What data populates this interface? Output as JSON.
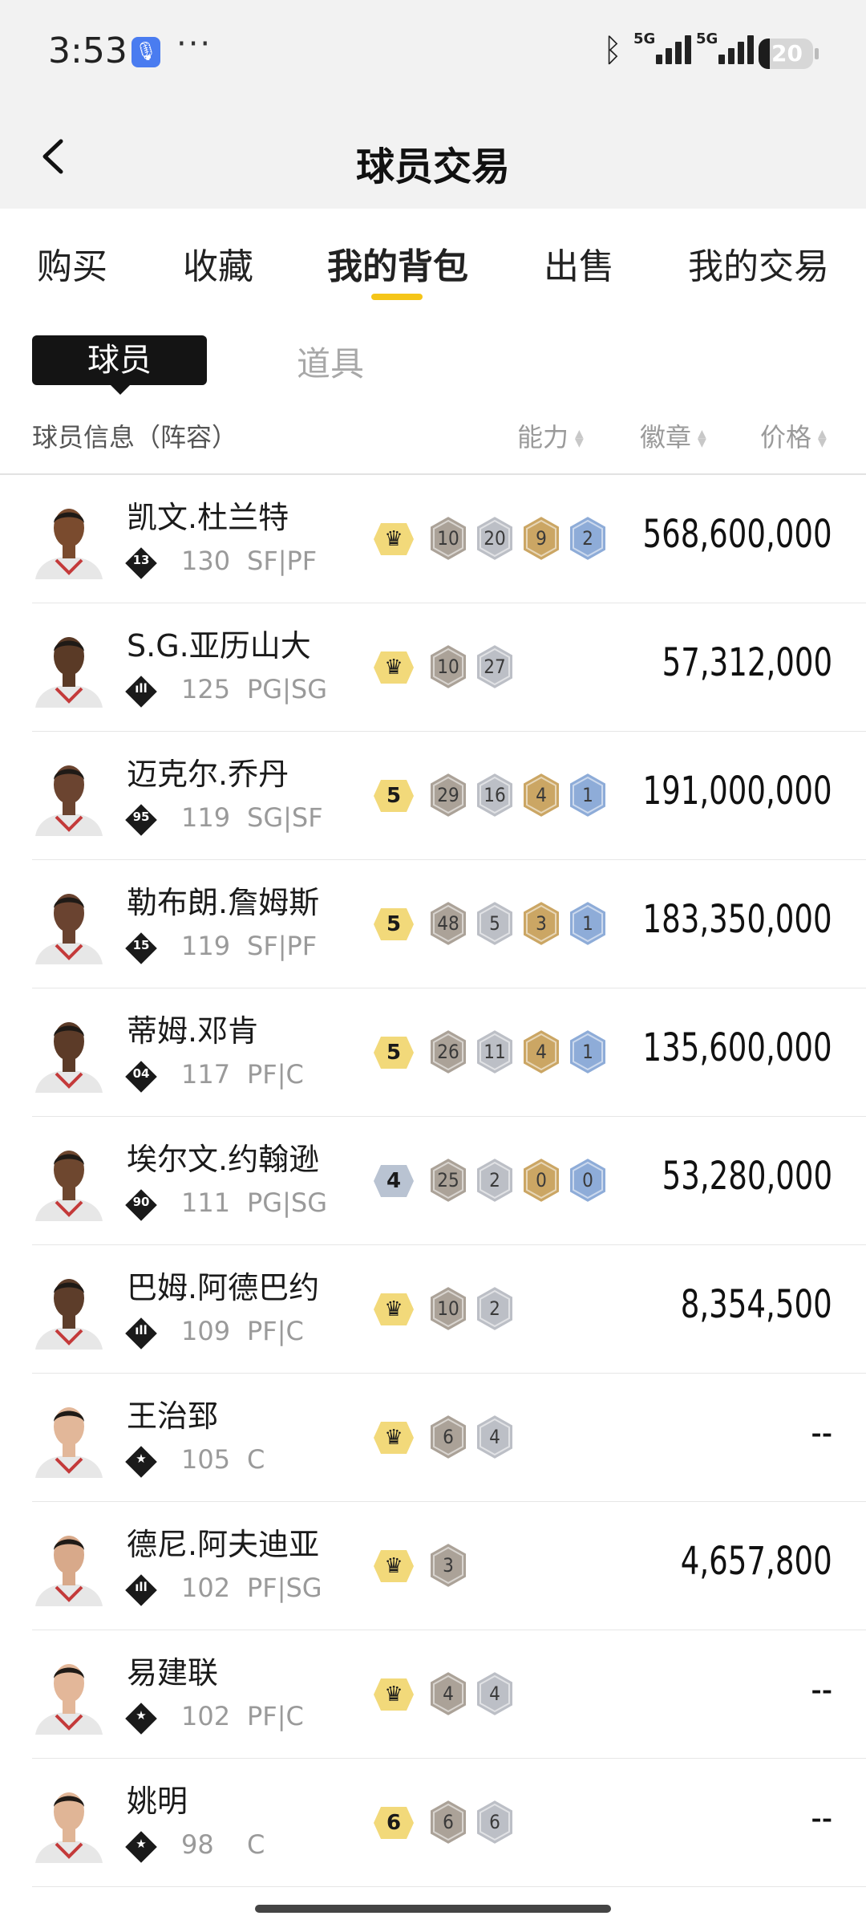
{
  "status_bar": {
    "time": "3:53",
    "signal_1_label": "5G",
    "signal_2_label": "5G",
    "battery_level": "20",
    "battery_fraction": 0.2
  },
  "header": {
    "title": "球员交易",
    "back_icon": "chevron-left-icon"
  },
  "tabs": [
    "购买",
    "收藏",
    "我的背包",
    "出售",
    "我的交易"
  ],
  "active_tab": 2,
  "sub_tabs": [
    "球员",
    "道具"
  ],
  "columns": {
    "info": "球员信息（阵容）",
    "ability": "能力",
    "badge": "徽章",
    "price": "价格"
  },
  "colors": {
    "accent": "#f5c518",
    "ability_gold": "#f2d97a",
    "ability_silver": "#b9c3d2",
    "badge_bronze": "#a79e93",
    "badge_silver": "#b9bcc4",
    "badge_gold": "#c9a25c",
    "badge_blue": "#89a8d6"
  },
  "players": [
    {
      "name": "凯文.杜兰特",
      "tag": "13",
      "rating": "130",
      "position": "SF|PF",
      "ability": "crown",
      "ability_color": "gold",
      "badges": [
        "10",
        "20",
        "9",
        "2"
      ],
      "price": "568,600,000"
    },
    {
      "name": "S.G.亚历山大",
      "tag": "bars",
      "rating": "125",
      "position": "PG|SG",
      "ability": "crown",
      "ability_color": "gold",
      "badges": [
        "10",
        "27"
      ],
      "price": "57,312,000"
    },
    {
      "name": "迈克尔.乔丹",
      "tag": "95",
      "rating": "119",
      "position": "SG|SF",
      "ability": "5",
      "ability_color": "gold",
      "badges": [
        "29",
        "16",
        "4",
        "1"
      ],
      "price": "191,000,000"
    },
    {
      "name": "勒布朗.詹姆斯",
      "tag": "15",
      "rating": "119",
      "position": "SF|PF",
      "ability": "5",
      "ability_color": "gold",
      "badges": [
        "48",
        "5",
        "3",
        "1"
      ],
      "price": "183,350,000"
    },
    {
      "name": "蒂姆.邓肯",
      "tag": "04",
      "rating": "117",
      "position": "PF|C",
      "ability": "5",
      "ability_color": "gold",
      "badges": [
        "26",
        "11",
        "4",
        "1"
      ],
      "price": "135,600,000"
    },
    {
      "name": "埃尔文.约翰逊",
      "tag": "90",
      "rating": "111",
      "position": "PG|SG",
      "ability": "4",
      "ability_color": "silver",
      "badges": [
        "25",
        "2",
        "0",
        "0"
      ],
      "price": "53,280,000"
    },
    {
      "name": "巴姆.阿德巴约",
      "tag": "bars",
      "rating": "109",
      "position": "PF|C",
      "ability": "crown",
      "ability_color": "gold",
      "badges": [
        "10",
        "2"
      ],
      "price": "8,354,500"
    },
    {
      "name": "王治郅",
      "tag": "star",
      "rating": "105",
      "position": "C",
      "ability": "crown",
      "ability_color": "gold",
      "badges": [
        "6",
        "4"
      ],
      "price": "--"
    },
    {
      "name": "德尼.阿夫迪亚",
      "tag": "bars",
      "rating": "102",
      "position": "PF|SG",
      "ability": "crown",
      "ability_color": "gold",
      "badges": [
        "3"
      ],
      "price": "4,657,800"
    },
    {
      "name": "易建联",
      "tag": "star",
      "rating": "102",
      "position": "PF|C",
      "ability": "crown",
      "ability_color": "gold",
      "badges": [
        "4",
        "4"
      ],
      "price": "--"
    },
    {
      "name": "姚明",
      "tag": "star",
      "rating": "98",
      "position": "C",
      "ability": "6",
      "ability_color": "gold",
      "badges": [
        "6",
        "6"
      ],
      "price": "--"
    }
  ]
}
